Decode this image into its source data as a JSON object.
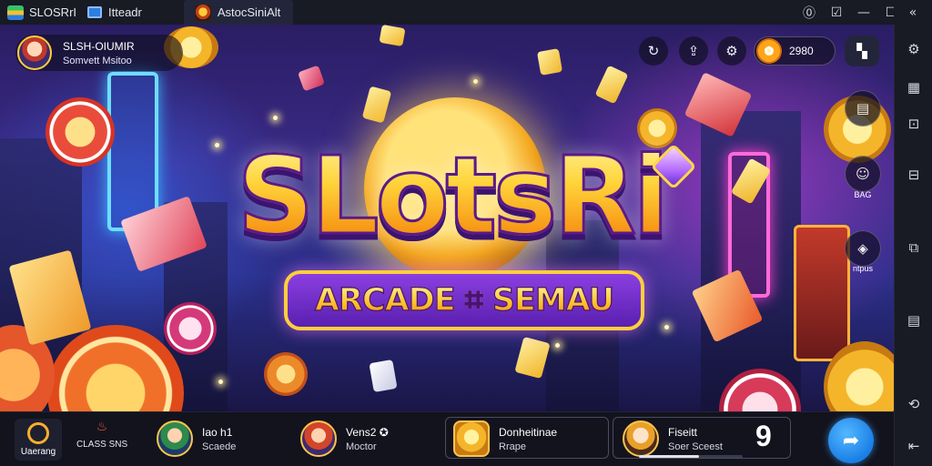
{
  "titlebar": {
    "app_name": "SLOSRrI",
    "home_tab": "Itteadr",
    "game_tab": "AstocSiniAlt",
    "controls": {
      "help_icon": "⓪",
      "screenshot_icon": "☑",
      "minimize": "—",
      "maximize": "☐",
      "close": "✕",
      "collapse": "«"
    }
  },
  "game": {
    "player": {
      "name": "SLSH-OIUMIR",
      "subtitle": "Somvett Msitoo"
    },
    "hud": {
      "refresh_icon": "↻",
      "share_icon": "⇪",
      "settings_icon": "⚙",
      "coin_icon": "✿",
      "coins": "2980",
      "menu_icon": "▚"
    },
    "logo": {
      "title": "SLotsRi",
      "subtitle": "ARCADE ⌗ SEMAU"
    },
    "side_items": [
      {
        "icon": "▤",
        "label": ""
      },
      {
        "icon": "☺",
        "label": "BAG"
      },
      {
        "icon": "◈",
        "label": "ntpus"
      }
    ]
  },
  "bottombar": {
    "home_label": "Uaerang",
    "brand_label": "CLASS SNS",
    "brand_icon": "♨",
    "items": [
      {
        "title": "Iao h1",
        "subtitle": "Scaede"
      },
      {
        "title": "Vens2 ✪",
        "subtitle": "Moctor"
      },
      {
        "title": "Donheitinae",
        "subtitle": "Rrape"
      },
      {
        "title": "Fiseitt",
        "subtitle": "Soer Sceest"
      }
    ],
    "big_number": "9",
    "progress": 0.58,
    "fab_icon": "➦"
  },
  "toolbar": {
    "top_icon": "«",
    "buttons": [
      "⚙",
      "▦",
      "⊡",
      "⊟",
      "⧉",
      "▤",
      "⟲",
      "⇤"
    ]
  }
}
